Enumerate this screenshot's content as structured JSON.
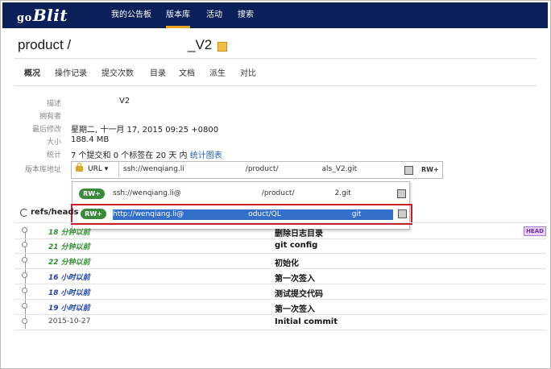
{
  "app": {
    "logo_prefix": "go",
    "logo": "Blit"
  },
  "nav": {
    "items": [
      "我的公告板",
      "版本库",
      "活动",
      "搜索"
    ],
    "active": "版本库"
  },
  "repo": {
    "name_prefix": "product",
    "name_suffix": "_V2"
  },
  "tabs": [
    "概况",
    "操作记录",
    "提交次数",
    "目录",
    "文档",
    "派生",
    "对比"
  ],
  "info": {
    "labels": [
      "描述",
      "拥有者",
      "最后修改",
      "大小",
      "统计",
      "版本库地址"
    ],
    "description": "V2",
    "last_modified": "星期二, 十一月 17, 2015 09:25 +0800",
    "size": "188.4 MB",
    "stats_text": "7 个提交和 0 个标签在 20 天 内",
    "stats_link": "统计图表"
  },
  "urlbar": {
    "protocol": "URL",
    "url_start": "ssh://wenqiang.li",
    "url_mid": "/product/",
    "url_end": "als_V2.git",
    "rw_label": "RW+"
  },
  "dropdown": {
    "rows": [
      {
        "badge": "RW+",
        "text_start": "ssh://wenqiang.li@",
        "text_mid": "/product/",
        "text_end": "2.git"
      },
      {
        "badge": "RW+",
        "text_start": "http://wenqiang.li@",
        "text_mid": "oduct/QL",
        "text_end": "git"
      }
    ]
  },
  "refs": {
    "title": "refs/heads"
  },
  "commits": [
    {
      "time": "18 分钟以前",
      "style": "green",
      "message": "删除日志目录",
      "badge": "HEAD"
    },
    {
      "time": "21 分钟以前",
      "style": "green",
      "message": "git config"
    },
    {
      "time": "22 分钟以前",
      "style": "green",
      "message": "初始化"
    },
    {
      "time": "16 小时以前",
      "style": "blue",
      "message": "第一次签入"
    },
    {
      "time": "18 小时以前",
      "style": "blue",
      "message": "测试提交代码"
    },
    {
      "time": "19 小时以前",
      "style": "blue",
      "message": "第一次签入"
    },
    {
      "time": "2015-10-27",
      "style": "plain",
      "message": "Initial commit"
    }
  ]
}
